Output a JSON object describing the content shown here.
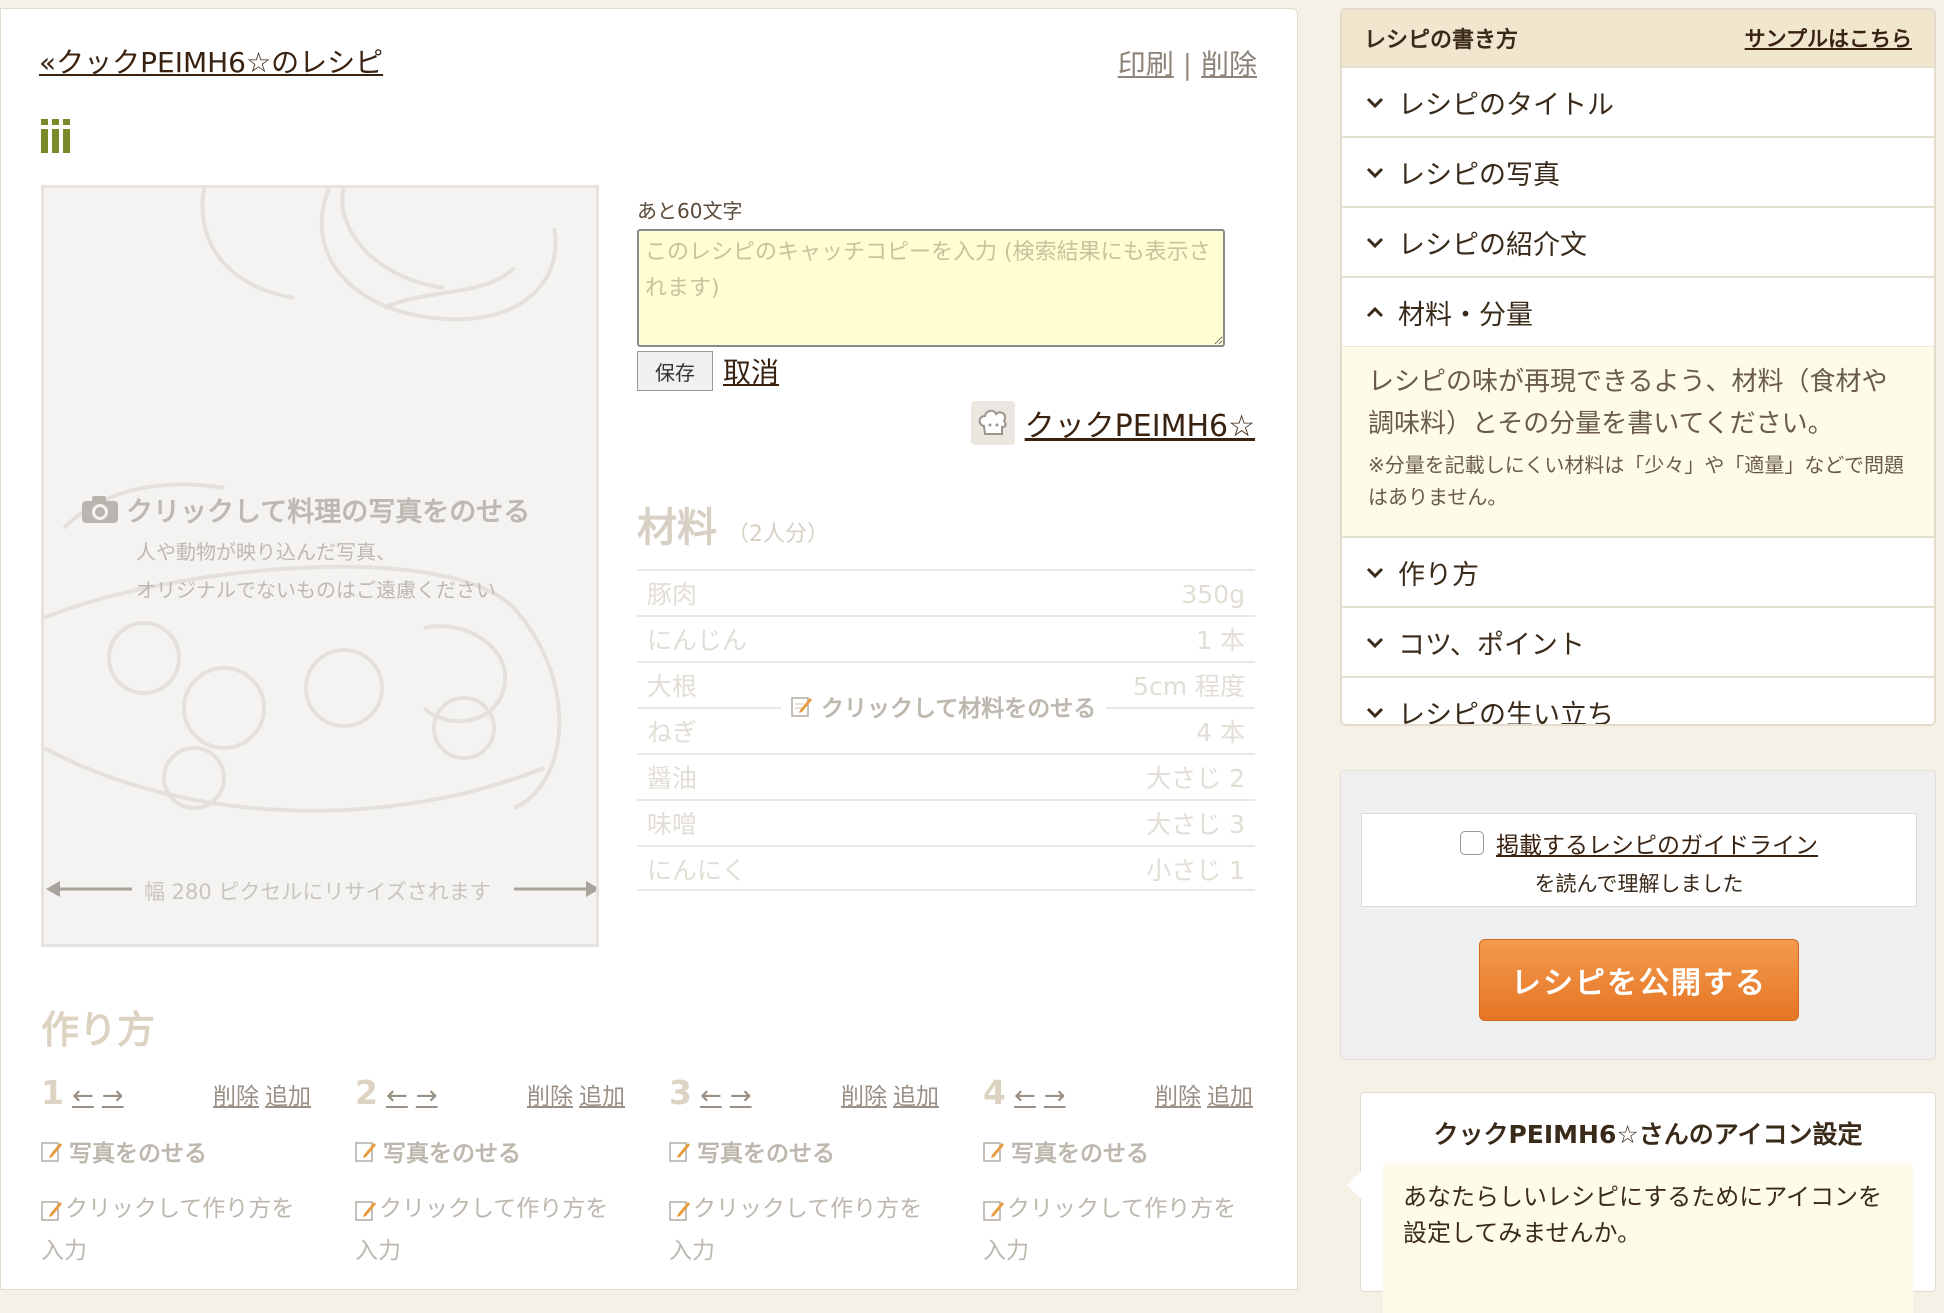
{
  "header": {
    "back_link": "«クックPEIMH6☆のレシピ",
    "print": "印刷",
    "separator": "|",
    "delete": "削除"
  },
  "photo": {
    "title": "クリックして料理の写真をのせる",
    "sub1": "人や動物が映り込んだ写真、",
    "sub2": "オリジナルでないものはご遠慮ください",
    "resize_note": "幅 280 ピクセルにリサイズされます"
  },
  "catchcopy": {
    "remaining": "あと60文字",
    "placeholder": "このレシピのキャッチコピーを入力 (検索結果にも表示されます)",
    "save": "保存",
    "cancel": "取消"
  },
  "author": {
    "name": "クックPEIMH6☆"
  },
  "ingredients": {
    "title": "材料",
    "servings": "（2人分）",
    "overlay": "クリックして材料をのせる",
    "rows": [
      {
        "name": "豚肉",
        "qty": "350g"
      },
      {
        "name": "にんじん",
        "qty": "1 本"
      },
      {
        "name": "大根",
        "qty": "5cm 程度"
      },
      {
        "name": "ねぎ",
        "qty": "4 本"
      },
      {
        "name": "醤油",
        "qty": "大さじ 2"
      },
      {
        "name": "味噌",
        "qty": "大さじ 3"
      },
      {
        "name": "にんにく",
        "qty": "小さじ 1"
      }
    ]
  },
  "steps": {
    "title": "作り方",
    "arrows": [
      "←",
      "→"
    ],
    "delete": "削除",
    "add": "追加",
    "photo": "写真をのせる",
    "text": "クリックして作り方を入力",
    "items": [
      {
        "num": "1"
      },
      {
        "num": "2"
      },
      {
        "num": "3"
      },
      {
        "num": "4"
      }
    ]
  },
  "guide": {
    "title": "レシピの書き方",
    "sample_link": "サンプルはこちら",
    "items": [
      {
        "label": "レシピのタイトル"
      },
      {
        "label": "レシピの写真"
      },
      {
        "label": "レシピの紹介文"
      },
      {
        "label": "材料・分量"
      },
      {
        "label": "作り方"
      },
      {
        "label": "コツ、ポイント"
      },
      {
        "label": "レシピの生い立ち"
      }
    ],
    "open_text": "レシピの味が再現できるよう、材料（食材や調味料）とその分量を書いてください。",
    "open_note": "※分量を記載しにくい材料は「少々」や「適量」などで問題はありません。"
  },
  "publish": {
    "guideline_link": "掲載するレシピのガイドライン",
    "guideline_suffix": "を読んで理解しました",
    "button": "レシピを公開する"
  },
  "icon_setting": {
    "title": "クックPEIMH6☆さんのアイコン設定",
    "body": "あなたらしいレシピにするためにアイコンを設定してみませんか。"
  },
  "colors": {
    "accent": "#e57524",
    "sidebar_head": "#f1e7cf",
    "input_bg": "#fffdd2",
    "logo": "#7a8a2a"
  }
}
